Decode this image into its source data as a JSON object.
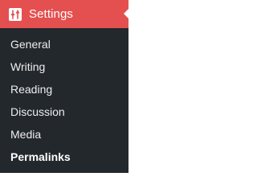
{
  "menu": {
    "title": "Settings",
    "icon": "settings-sliders-icon",
    "accent_color": "#e4504f",
    "background_color": "#23282d",
    "items": [
      {
        "label": "General",
        "active": false
      },
      {
        "label": "Writing",
        "active": false
      },
      {
        "label": "Reading",
        "active": false
      },
      {
        "label": "Discussion",
        "active": false
      },
      {
        "label": "Media",
        "active": false
      },
      {
        "label": "Permalinks",
        "active": true
      }
    ]
  }
}
